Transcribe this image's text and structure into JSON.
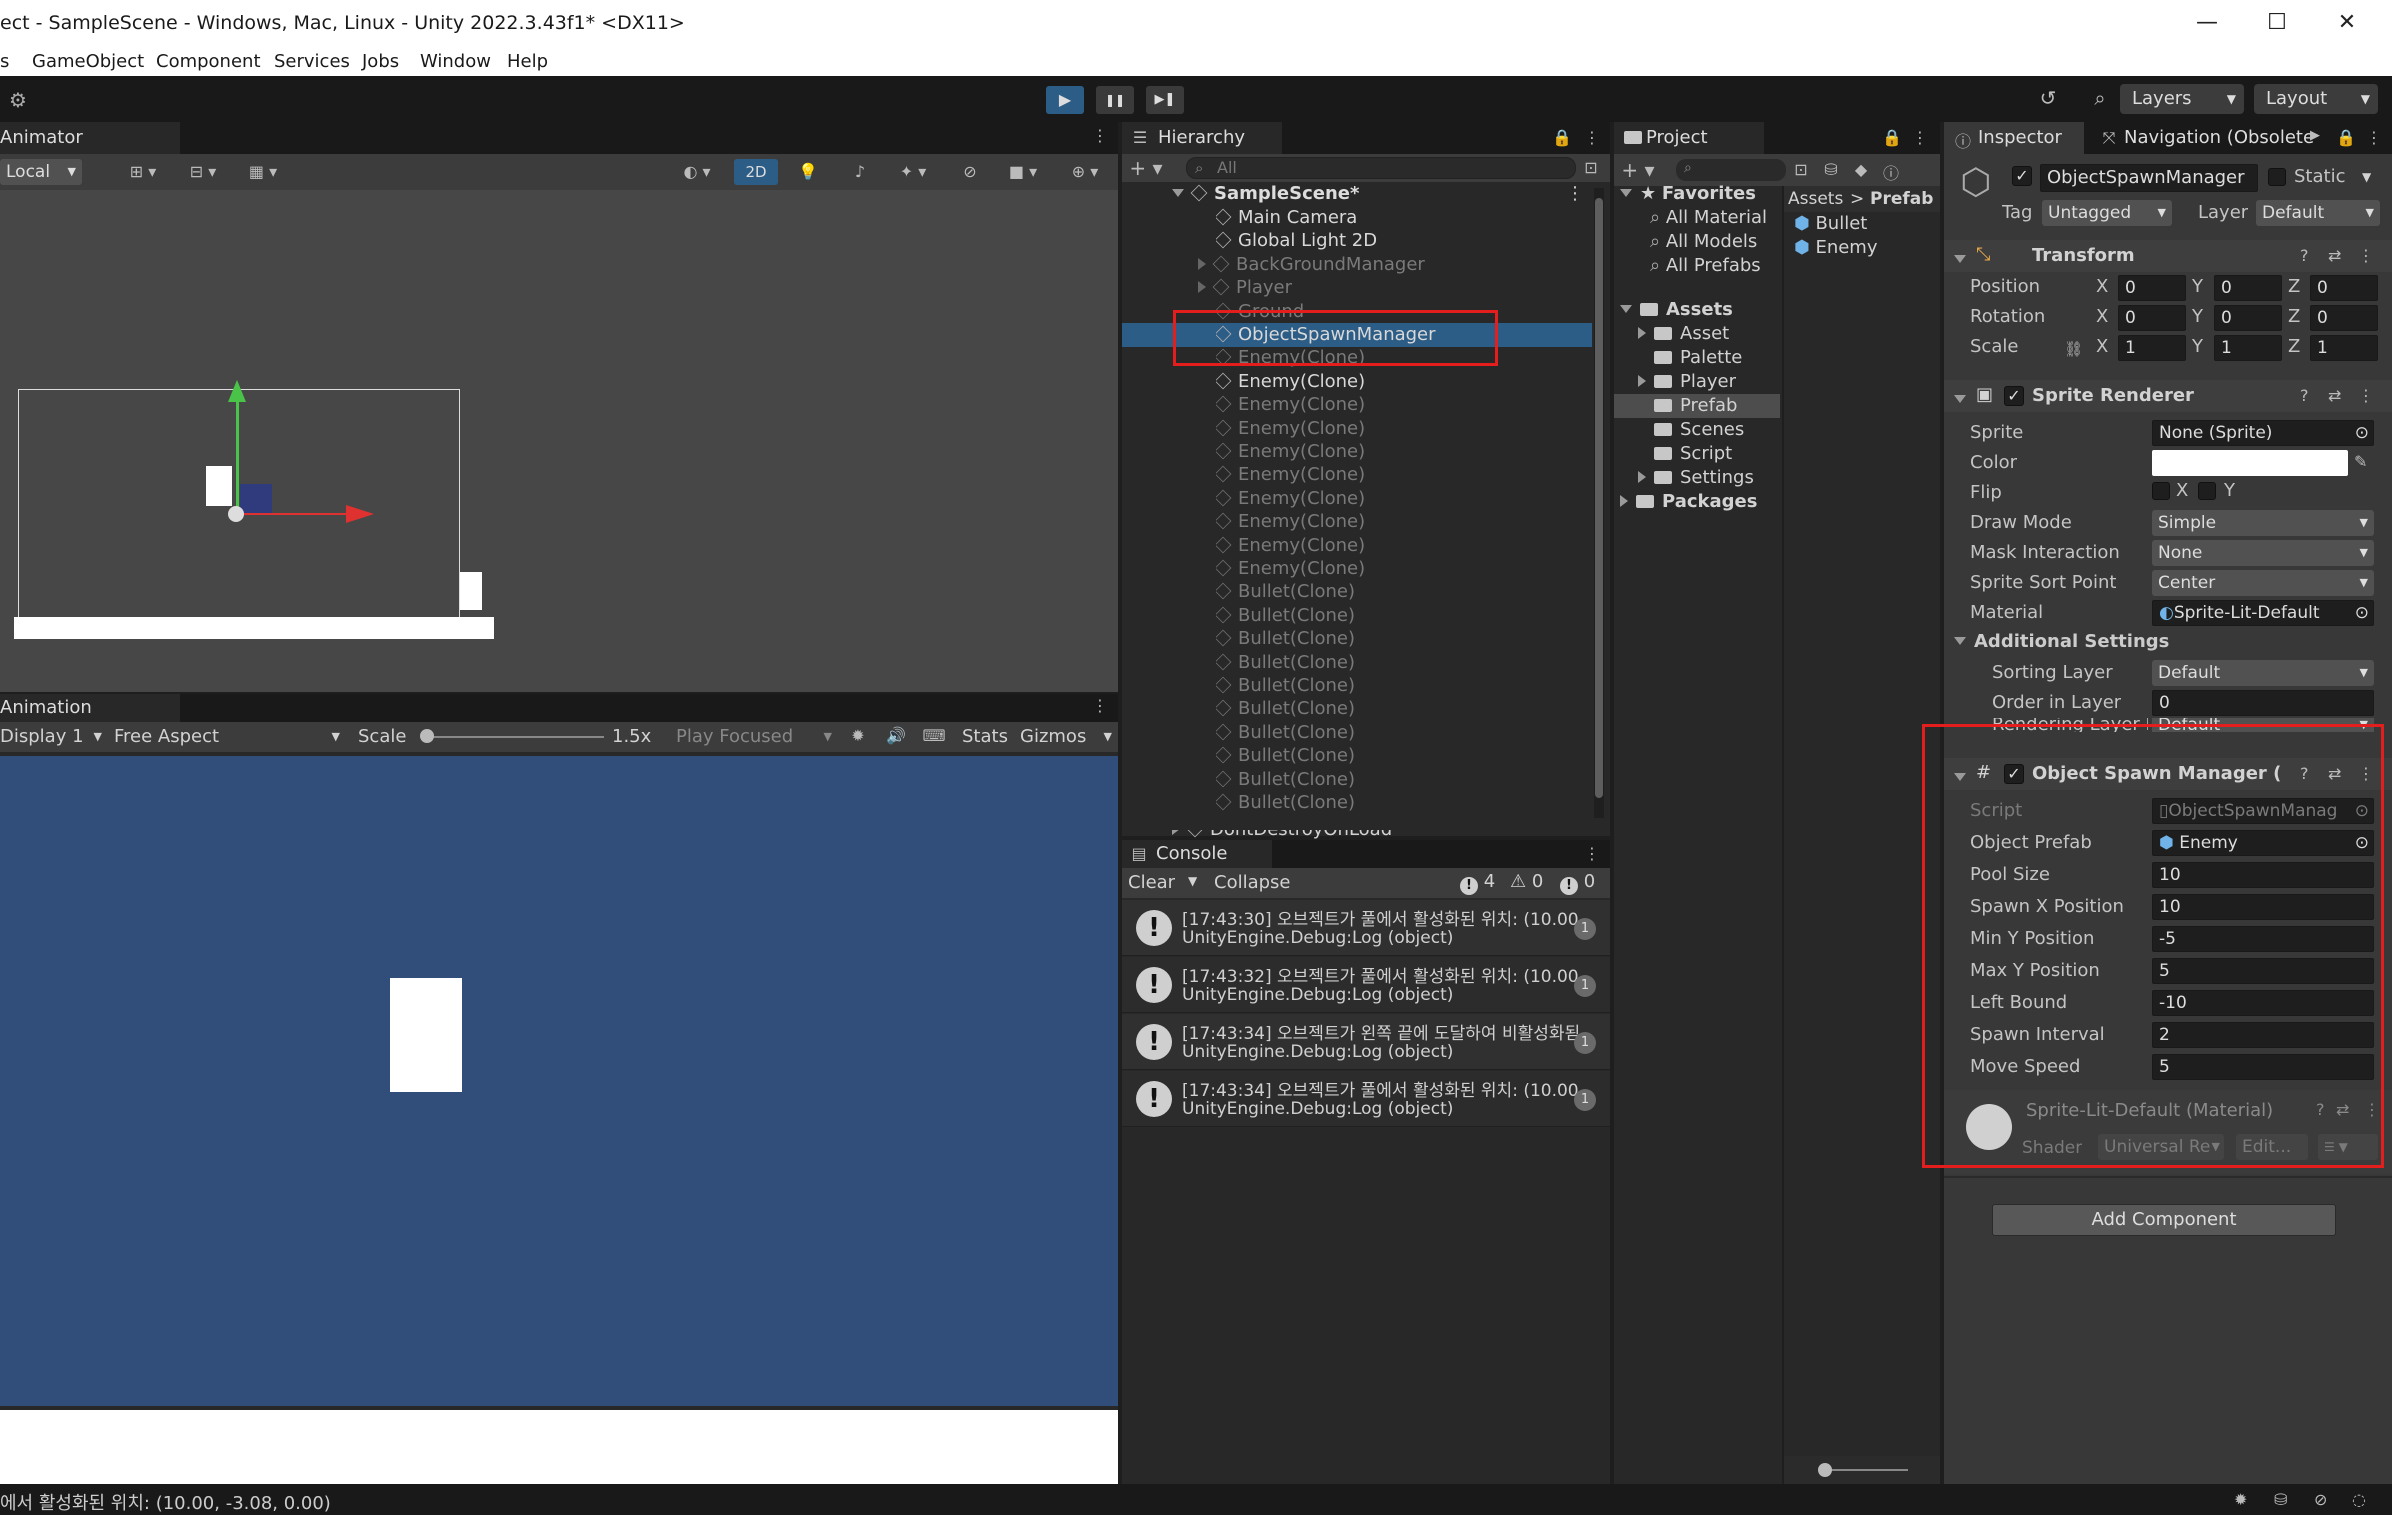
{
  "window": {
    "title": "ect - SampleScene - Windows, Mac, Linux - Unity 2022.3.43f1* <DX11>",
    "controls": [
      "—",
      "☐",
      "✕"
    ]
  },
  "menu": [
    "s",
    "GameObject",
    "Component",
    "Services",
    "Jobs",
    "Window",
    "Help"
  ],
  "toolbar": {
    "play": "▶",
    "pause": "❚❚",
    "step": "▶❚",
    "layers": "Layers",
    "layout": "Layout"
  },
  "scene": {
    "tab": "Animator",
    "pivot": "Local",
    "mode2d": "2D"
  },
  "game": {
    "tab": "Animation",
    "display": "Display 1",
    "aspect": "Free Aspect",
    "scale_label": "Scale",
    "scale_value": "1.5x",
    "play_focused": "Play Focused",
    "stats": "Stats",
    "gizmos": "Gizmos"
  },
  "hierarchy": {
    "tab": "Hierarchy",
    "search_placeholder": "All",
    "scene": "SampleScene*",
    "items": [
      {
        "label": "Main Camera",
        "dim": false,
        "expand": false
      },
      {
        "label": "Global Light 2D",
        "dim": false,
        "expand": false
      },
      {
        "label": "BackGroundManager",
        "dim": true,
        "expand": true
      },
      {
        "label": "Player",
        "dim": true,
        "expand": true
      },
      {
        "label": "Ground",
        "dim": true,
        "expand": false
      },
      {
        "label": "ObjectSpawnManager",
        "dim": false,
        "expand": false,
        "selected": true
      },
      {
        "label": "Enemy(Clone)",
        "dim": true,
        "expand": false
      },
      {
        "label": "Enemy(Clone)",
        "dim": false,
        "expand": false
      },
      {
        "label": "Enemy(Clone)",
        "dim": true,
        "expand": false
      },
      {
        "label": "Enemy(Clone)",
        "dim": true,
        "expand": false
      },
      {
        "label": "Enemy(Clone)",
        "dim": true,
        "expand": false
      },
      {
        "label": "Enemy(Clone)",
        "dim": true,
        "expand": false
      },
      {
        "label": "Enemy(Clone)",
        "dim": true,
        "expand": false
      },
      {
        "label": "Enemy(Clone)",
        "dim": true,
        "expand": false
      },
      {
        "label": "Enemy(Clone)",
        "dim": true,
        "expand": false
      },
      {
        "label": "Enemy(Clone)",
        "dim": true,
        "expand": false
      },
      {
        "label": "Bullet(Clone)",
        "dim": true,
        "expand": false
      },
      {
        "label": "Bullet(Clone)",
        "dim": true,
        "expand": false
      },
      {
        "label": "Bullet(Clone)",
        "dim": true,
        "expand": false
      },
      {
        "label": "Bullet(Clone)",
        "dim": true,
        "expand": false
      },
      {
        "label": "Bullet(Clone)",
        "dim": true,
        "expand": false
      },
      {
        "label": "Bullet(Clone)",
        "dim": true,
        "expand": false
      },
      {
        "label": "Bullet(Clone)",
        "dim": true,
        "expand": false
      },
      {
        "label": "Bullet(Clone)",
        "dim": true,
        "expand": false
      },
      {
        "label": "Bullet(Clone)",
        "dim": true,
        "expand": false
      },
      {
        "label": "Bullet(Clone)",
        "dim": true,
        "expand": false
      }
    ],
    "dont_destroy": "DontDestroyOnLoad"
  },
  "project": {
    "tab": "Project",
    "favorites": "Favorites",
    "fav_items": [
      "All Material",
      "All Models",
      "All Prefabs"
    ],
    "assets": "Assets",
    "asset_items": [
      {
        "label": "Asset",
        "expand": true
      },
      {
        "label": "Palette",
        "expand": false
      },
      {
        "label": "Player",
        "expand": true
      },
      {
        "label": "Prefab",
        "expand": false,
        "selected": true
      },
      {
        "label": "Scenes",
        "expand": false
      },
      {
        "label": "Script",
        "expand": false
      },
      {
        "label": "Settings",
        "expand": true
      }
    ],
    "packages": "Packages",
    "breadcrumb": [
      "Assets",
      ">",
      "Prefab"
    ],
    "files": [
      "Bullet",
      "Enemy"
    ]
  },
  "console": {
    "tab": "Console",
    "clear": "Clear",
    "collapse": "Collapse",
    "count_logs": "4",
    "count_warn": "0",
    "count_err": "0",
    "entries": [
      {
        "line1": "[17:43:30] 오브젝트가 풀에서 활성화된 위치: (10.00",
        "line2": "UnityEngine.Debug:Log (object)",
        "count": "1"
      },
      {
        "line1": "[17:43:32] 오브젝트가 풀에서 활성화된 위치: (10.00",
        "line2": "UnityEngine.Debug:Log (object)",
        "count": "1"
      },
      {
        "line1": "[17:43:34] 오브젝트가 왼쪽 끝에 도달하여 비활성화됨",
        "line2": "UnityEngine.Debug:Log (object)",
        "count": "1"
      },
      {
        "line1": "[17:43:34] 오브젝트가 풀에서 활성화된 위치: (10.00",
        "line2": "UnityEngine.Debug:Log (object)",
        "count": "1"
      }
    ]
  },
  "inspector": {
    "tab": "Inspector",
    "tab2": "Navigation (Obsolete",
    "object_name": "ObjectSpawnManager",
    "static": "Static",
    "tag_label": "Tag",
    "tag_value": "Untagged",
    "layer_label": "Layer",
    "layer_value": "Default",
    "transform": {
      "title": "Transform",
      "rows": [
        {
          "label": "Position",
          "x": "0",
          "y": "0",
          "z": "0"
        },
        {
          "label": "Rotation",
          "x": "0",
          "y": "0",
          "z": "0"
        },
        {
          "label": "Scale",
          "x": "1",
          "y": "1",
          "z": "1"
        }
      ],
      "axis_x": "X",
      "axis_y": "Y",
      "axis_z": "Z"
    },
    "sprite_renderer": {
      "title": "Sprite Renderer",
      "sprite_label": "Sprite",
      "sprite_value": "None (Sprite)",
      "color_label": "Color",
      "color_value": "#ffffff",
      "flip_label": "Flip",
      "flip_x": "X",
      "flip_y": "Y",
      "draw_mode_label": "Draw Mode",
      "draw_mode_value": "Simple",
      "mask_label": "Mask Interaction",
      "mask_value": "None",
      "sort_point_label": "Sprite Sort Point",
      "sort_point_value": "Center",
      "material_label": "Material",
      "material_value": "Sprite-Lit-Default",
      "additional": "Additional Settings",
      "sorting_layer_label": "Sorting Layer",
      "sorting_layer_value": "Default",
      "order_label": "Order in Layer",
      "order_value": "0",
      "rendering_layer_label": "Rendering Layer M",
      "rendering_layer_value": "Default"
    },
    "spawn_manager": {
      "title": "Object Spawn Manager (Sc",
      "script_label": "Script",
      "script_value": "ObjectSpawnManag",
      "prefab_label": "Object Prefab",
      "prefab_value": "Enemy",
      "fields": [
        {
          "label": "Pool Size",
          "value": "10"
        },
        {
          "label": "Spawn X Position",
          "value": "10"
        },
        {
          "label": "Min Y Position",
          "value": "-5"
        },
        {
          "label": "Max Y Position",
          "value": "5"
        },
        {
          "label": "Left Bound",
          "value": "-10"
        },
        {
          "label": "Spawn Interval",
          "value": "2"
        },
        {
          "label": "Move Speed",
          "value": "5"
        }
      ]
    },
    "material": {
      "title": "Sprite-Lit-Default (Material)",
      "shader_label": "Shader",
      "shader_value": "Universal Re",
      "edit": "Edit..."
    },
    "add_component": "Add Component"
  },
  "statusbar": "에서 활성화된 위치: (10.00, -3.08, 0.00)",
  "colors": {
    "accent": "#2c5d87",
    "game_bg": "#314d79",
    "highlight": "#e41d1d"
  }
}
